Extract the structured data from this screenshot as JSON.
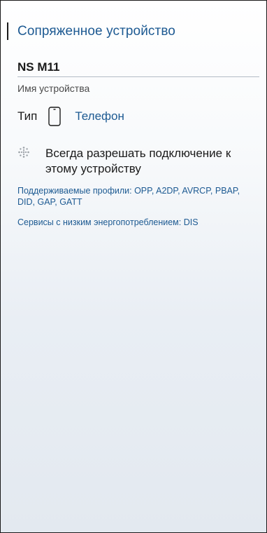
{
  "header": {
    "title": "Сопряженное устройство"
  },
  "device": {
    "name_value": "NS M11",
    "name_caption": "Имя устройства",
    "type_label": "Тип",
    "type_value": "Телефон",
    "type_icon": "phone-icon"
  },
  "connection": {
    "always_allow_text": "Всегда разрешать подключение к этому устройству",
    "toggle_icon": "dotted-toggle-icon"
  },
  "info": {
    "profiles": "Поддерживаемые профили: OPP, A2DP, AVRCP, PBAP, DID, GAP, GATT",
    "low_energy_services": "Сервисы с низким энергопотреблением: DIS"
  },
  "colors": {
    "accent": "#1d5a92",
    "text": "#1a1a1a",
    "caption": "#4a4a4a"
  }
}
